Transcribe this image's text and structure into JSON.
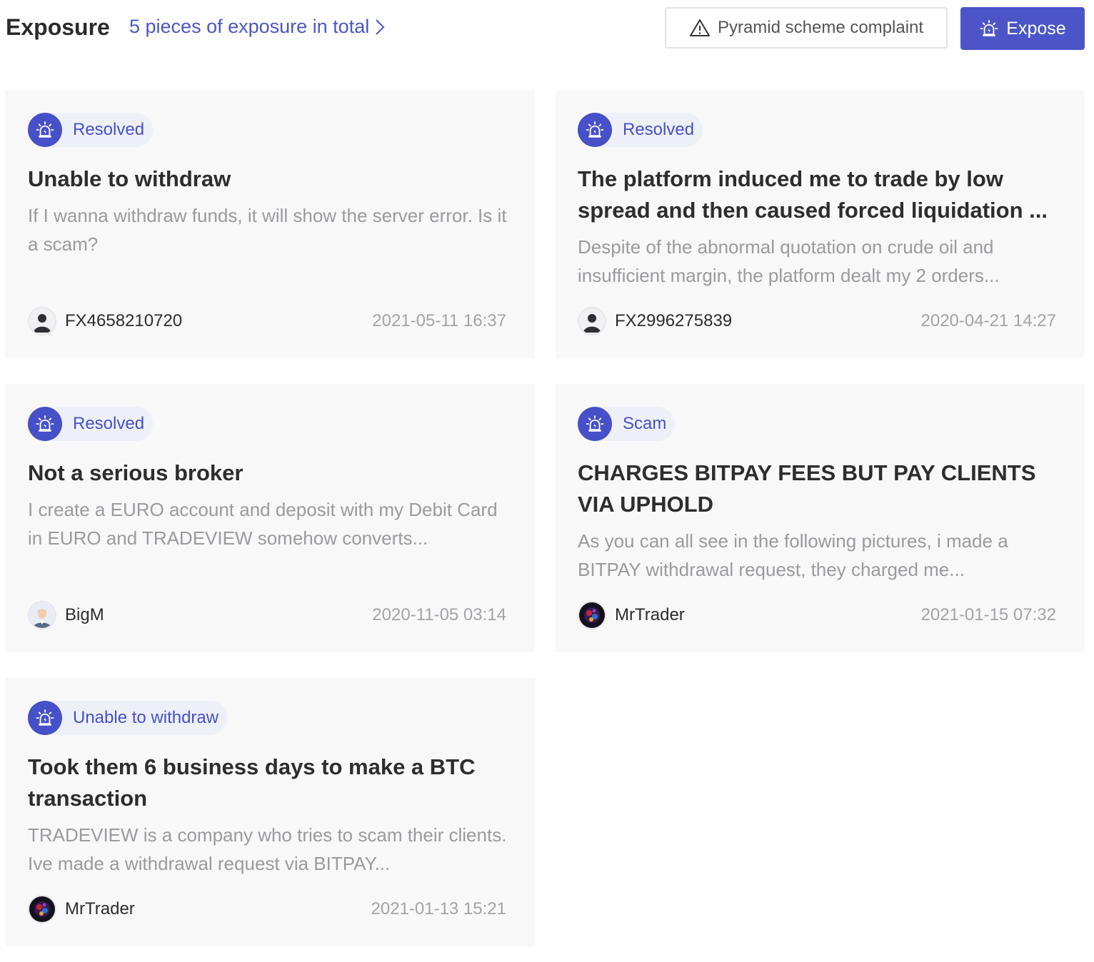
{
  "header": {
    "title": "Exposure",
    "total_link": "5 pieces of exposure in total",
    "complaint_button": "Pyramid scheme complaint",
    "expose_button": "Expose"
  },
  "cards": [
    {
      "tag": "Resolved",
      "title": "Unable to withdraw",
      "description": "If I wanna withdraw funds, it will show the server error. Is it a scam?",
      "author": "FX4658210720",
      "date": "2021-05-11 16:37",
      "avatar": "default-user"
    },
    {
      "tag": "Resolved",
      "title": "The platform induced me to trade by low spread and then caused forced liquidation ...",
      "description": "Despite of the abnormal quotation on crude oil and insufficient margin, the platform dealt my 2 orders...",
      "author": "FX2996275839",
      "date": "2020-04-21 14:27",
      "avatar": "default-user"
    },
    {
      "tag": "Resolved",
      "title": "Not a serious broker",
      "description": "I create a EURO account and deposit with my Debit Card in EURO and TRADEVIEW somehow converts...",
      "author": "BigM",
      "date": "2020-11-05 03:14",
      "avatar": "person-photo"
    },
    {
      "tag": "Scam",
      "title": "CHARGES BITPAY FEES BUT PAY CLIENTS VIA UPHOLD",
      "description": "As you can all see in the following pictures, i made a BITPAY withdrawal request, they charged me...",
      "author": "MrTrader",
      "date": "2021-01-15 07:32",
      "avatar": "dark-art"
    },
    {
      "tag": "Unable to withdraw",
      "title": "Took them 6 business days to make a BTC transaction",
      "description": "TRADEVIEW is a company who tries to scam their clients. Ive made a withdrawal request via BITPAY...",
      "author": "MrTrader",
      "date": "2021-01-13 15:21",
      "avatar": "dark-art"
    }
  ]
}
